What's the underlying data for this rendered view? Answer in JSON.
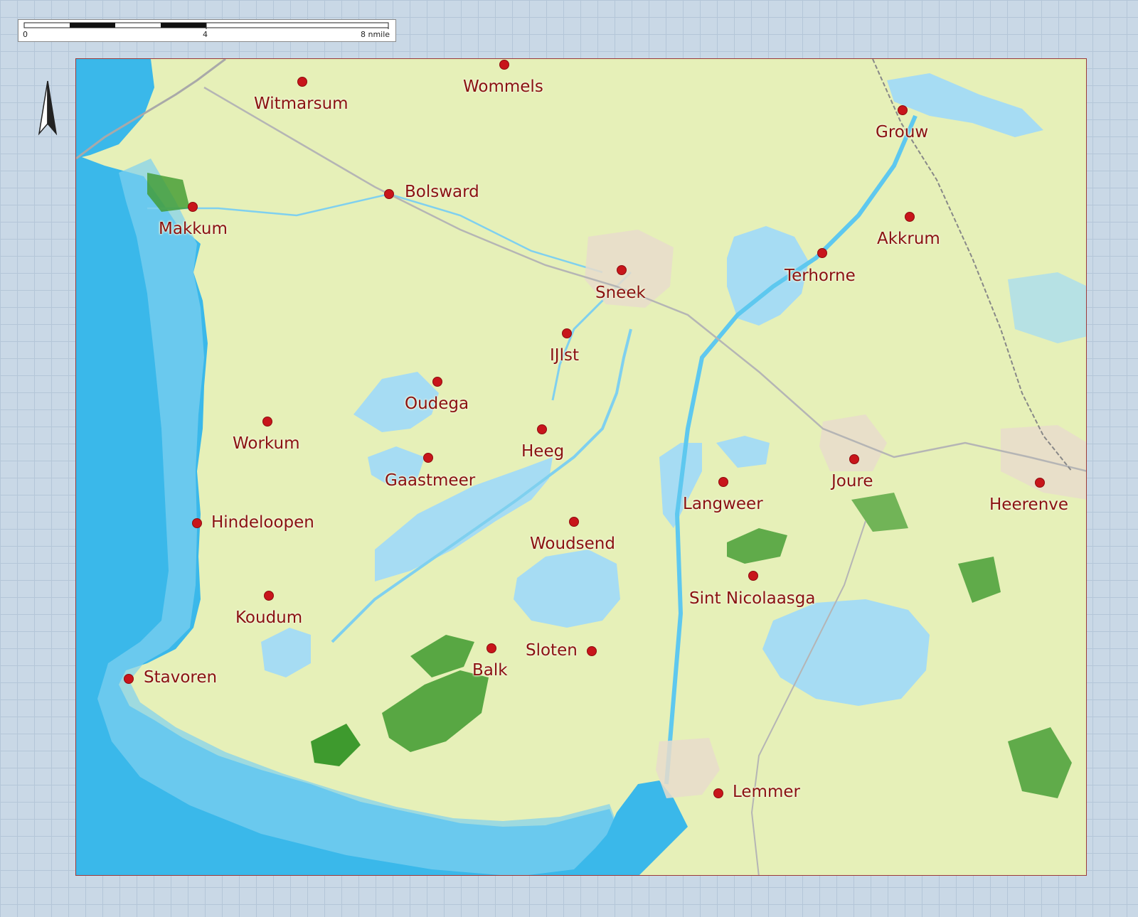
{
  "scale_bar": {
    "labels": [
      "0",
      "4",
      "8 nmile"
    ]
  },
  "north_arrow": {
    "icon": "north-arrow-icon"
  },
  "colors": {
    "land": "#e6f0b8",
    "water_deep": "#3ab8ea",
    "water_shallow": "#a6dcf3",
    "lake": "#bfe5f6",
    "forest": "#3e9a2e",
    "town_marker": "#c8151b",
    "label": "#8a1111",
    "frame": "#9b3a3a"
  },
  "towns": [
    {
      "name": "Wommels"
    },
    {
      "name": "Witmarsum"
    },
    {
      "name": "Grouw"
    },
    {
      "name": "Bolsward"
    },
    {
      "name": "Makkum"
    },
    {
      "name": "Akkrum"
    },
    {
      "name": "Terhorne"
    },
    {
      "name": "Sneek"
    },
    {
      "name": "IJlst"
    },
    {
      "name": "Oudega"
    },
    {
      "name": "Workum"
    },
    {
      "name": "Heeg"
    },
    {
      "name": "Gaastmeer"
    },
    {
      "name": "Joure"
    },
    {
      "name": "Langweer"
    },
    {
      "name": "Heerenve"
    },
    {
      "name": "Hindeloopen"
    },
    {
      "name": "Woudsend"
    },
    {
      "name": "Sint Nicolaasga"
    },
    {
      "name": "Koudum"
    },
    {
      "name": "Sloten"
    },
    {
      "name": "Balk"
    },
    {
      "name": "Stavoren"
    },
    {
      "name": "Lemmer"
    }
  ]
}
